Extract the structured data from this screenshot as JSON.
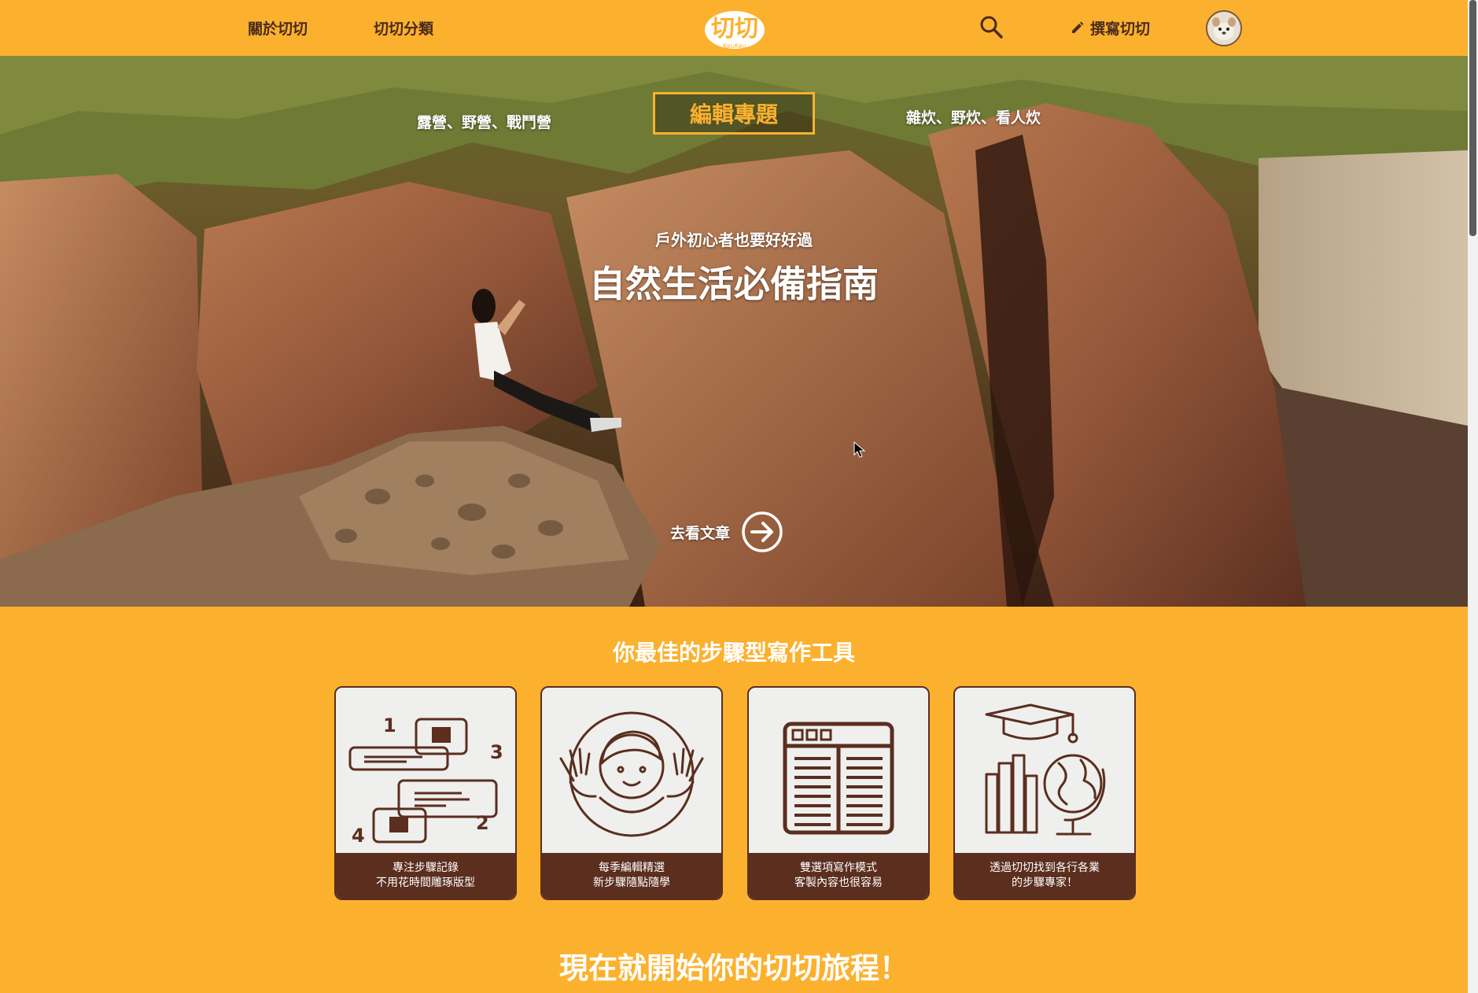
{
  "nav": {
    "about_label": "關於切切",
    "categories_label": "切切分類",
    "logo_text": "切切",
    "logo_subtext": "KeuKeu",
    "search_icon": "search-icon",
    "write_label": "撰寫切切",
    "write_icon": "pencil-icon",
    "avatar_icon": "avatar"
  },
  "hero": {
    "tag_left": "露營、野營、戰鬥營",
    "badge": "編輯專題",
    "tag_right": "雜炊、野炊、看人炊",
    "subtitle": "戶外初心者也要好好過",
    "title": "自然生活必備指南",
    "cta_label": "去看文章",
    "cta_icon": "arrow-right-circle-icon"
  },
  "features": {
    "title": "你最佳的步驟型寫作工具",
    "cards": [
      {
        "icon": "steps-illustration-icon",
        "line1": "專注步驟記錄",
        "line2": "不用花時間雕琢版型"
      },
      {
        "icon": "waving-person-icon",
        "line1": "每季編輯精選",
        "line2": "新步驟隨點隨學"
      },
      {
        "icon": "two-column-layout-icon",
        "line1": "雙選項寫作模式",
        "line2": "客製內容也很容易"
      },
      {
        "icon": "education-globe-icon",
        "line1": "透過切切找到各行各業",
        "line2": "的步驟專家！"
      }
    ]
  },
  "cta_bottom": {
    "title": "現在就開始你的切切旅程！"
  },
  "colors": {
    "brand_yellow": "#fbb12e",
    "brown": "#5b2e1e",
    "text_dark": "#4a2a1c"
  }
}
